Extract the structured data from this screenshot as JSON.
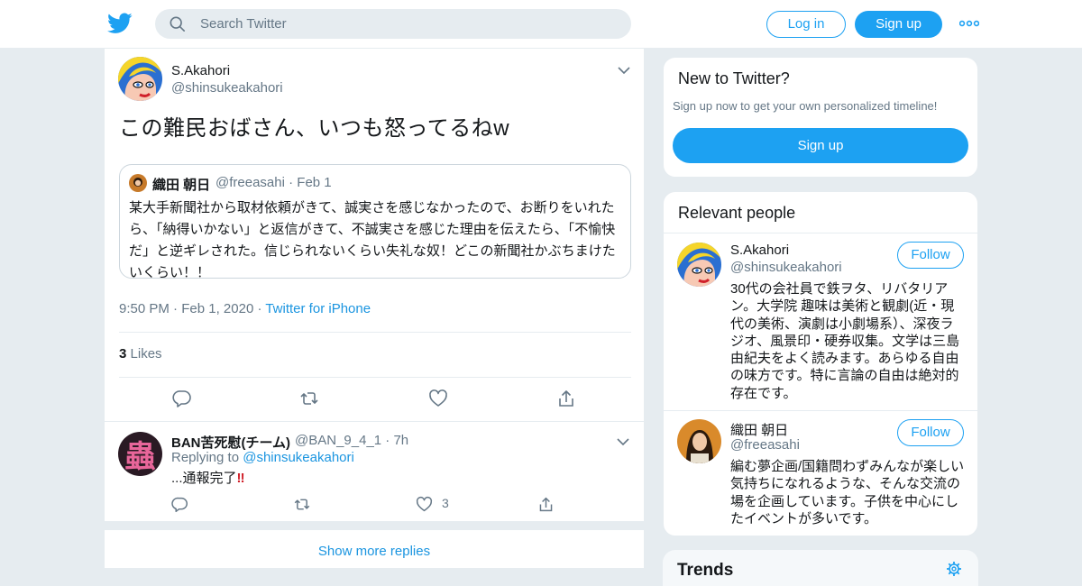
{
  "header": {
    "search_placeholder": "Search Twitter",
    "login_label": "Log in",
    "signup_label": "Sign up",
    "more_icon": "more-dots-icon",
    "logo_icon": "twitter-bird-icon"
  },
  "tweet": {
    "author_name": "S.Akahori",
    "author_handle": "@shinsukeakahori",
    "text": "この難民おばさん、いつも怒ってるねw",
    "quote": {
      "author_name": "織田 朝日",
      "author_handle": "@freeasahi",
      "date": "Feb 1",
      "text": "某大手新聞社から取材依頼がきて、誠実さを感じなかったので、お断りをいれたら、「納得いかない」と返信がきて、不誠実さを感じた理由を伝えたら、「不愉快だ」と逆ギレされた。信じられないくらい失礼な奴！どこの新聞社かぶちまけたいくらい！！"
    },
    "time": "9:50 PM",
    "date": "Feb 1, 2020",
    "source": "Twitter for iPhone",
    "likes_count": "3",
    "likes_label": "Likes"
  },
  "reply": {
    "author_name": "BAN苦死慰(チーム)",
    "author_handle": "@BAN_9_4_1",
    "time": "7h",
    "replying_prefix": "Replying to",
    "replying_to": "@shinsukeakahori",
    "text": "...通報完了",
    "like_count": "3"
  },
  "show_more_label": "Show more replies",
  "new_to_twitter": {
    "title": "New to Twitter?",
    "subtitle": "Sign up now to get your own personalized timeline!",
    "button_label": "Sign up"
  },
  "relevant_people": {
    "title": "Relevant people",
    "people": [
      {
        "name": "S.Akahori",
        "handle": "@shinsukeakahori",
        "follow_label": "Follow",
        "bio": "30代の会社員で鉄ヲタ、リバタリアン。大学院 趣味は美術と観劇(近・現代の美術、演劇は小劇場系）、深夜ラジオ、風景印・硬券収集。文学は三島由紀夫をよく読みます。あらゆる自由の味方です。特に言論の自由は絶対的存在です。"
      },
      {
        "name": "織田 朝日",
        "handle": "@freeasahi",
        "follow_label": "Follow",
        "bio": "編む夢企画/国籍問わずみんなが楽しい気持ちになれるような、そんな交流の場を企画しています。子供を中心にしたイベントが多いです。"
      }
    ]
  },
  "trends": {
    "title": "Trends"
  },
  "colors": {
    "accent": "#1da1f2",
    "link": "#1b95e0",
    "muted": "#657786",
    "background": "#e6ecf0"
  }
}
